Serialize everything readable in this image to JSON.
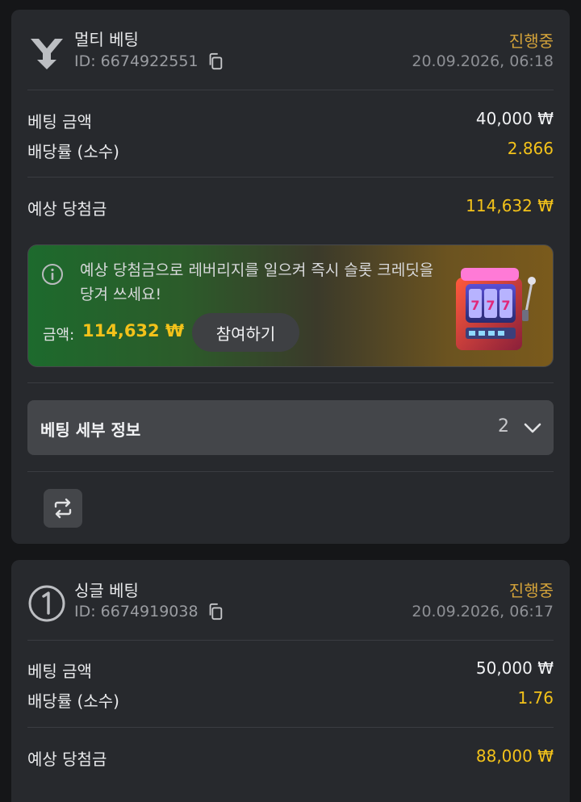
{
  "bets": [
    {
      "title": "멀티 베팅",
      "id_label": "ID: 6674922551",
      "status": "진행중",
      "date": "20.09.2026, 06:18",
      "stake_label": "베팅 금액",
      "stake_value": "40,000 ₩",
      "odds_label": "배당률 (소수)",
      "odds_value": "2.866",
      "payout_label": "예상 당첨금",
      "payout_value": "114,632 ₩",
      "icon": "multi-bet-icon"
    },
    {
      "title": "싱글 베팅",
      "id_label": "ID: 6674919038",
      "status": "진행중",
      "date": "20.09.2026, 06:17",
      "stake_label": "베팅 금액",
      "stake_value": "50,000 ₩",
      "odds_label": "배당률 (소수)",
      "odds_value": "1.76",
      "payout_label": "예상 당첨금",
      "payout_value": "88,000 ₩",
      "icon": "single-bet-icon"
    }
  ],
  "promo": {
    "text": "예상 당첨금으로 레버리지를 일으켜 즉시 슬롯 크레딧을 당겨 쓰세요!",
    "amount_label": "금액:",
    "amount_value": "114,632 ₩",
    "button_label": "참여하기",
    "image": "slot-machine-icon"
  },
  "details": {
    "label": "베팅 세부 정보",
    "count": "2"
  },
  "colors": {
    "status": "#d4a33a",
    "accent": "#f3c21a",
    "card": "#27292d",
    "background": "#151618"
  }
}
